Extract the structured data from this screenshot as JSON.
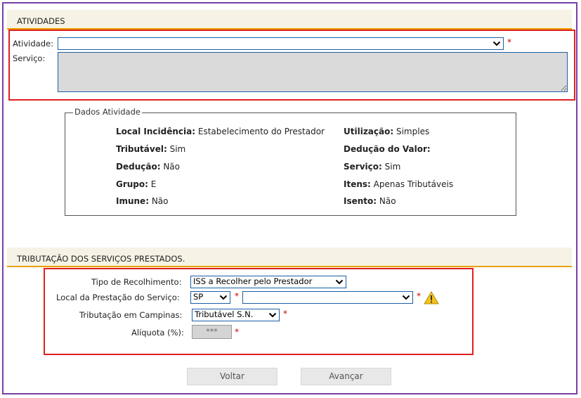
{
  "atividades": {
    "header": "ATIVIDADES",
    "atividade_label": "Atividade:",
    "atividade_value": "",
    "servico_label": "Serviço:",
    "servico_value": "",
    "required_mark": "*"
  },
  "dados_atividade": {
    "legend": "Dados Atividade",
    "rows": [
      {
        "k1": "Local Incidência:",
        "v1": "Estabelecimento do Prestador",
        "k2": "Utilização:",
        "v2": "Simples"
      },
      {
        "k1": "Tributável:",
        "v1": "Sim",
        "k2": "Dedução do Valor:",
        "v2": ""
      },
      {
        "k1": "Dedução:",
        "v1": "Não",
        "k2": "Serviço:",
        "v2": "Sim"
      },
      {
        "k1": "Grupo:",
        "v1": "E",
        "k2": "Itens:",
        "v2": "Apenas Tributáveis"
      },
      {
        "k1": "Imune:",
        "v1": "Não",
        "k2": "Isento:",
        "v2": "Não"
      }
    ]
  },
  "tributacao": {
    "header": "TRIBUTAÇÃO DOS SERVIÇOS PRESTADOS.",
    "tipo_label": "Tipo de Recolhimento:",
    "tipo_value": "ISS a Recolher pelo Prestador",
    "local_label": "Local da Prestação do Serviço:",
    "local_uf": "SP",
    "local_cidade": "",
    "trib_label": "Tributação em Campinas:",
    "trib_value": "Tributável S.N.",
    "aliquota_label": "Alíquota (%):",
    "aliquota_value": "***",
    "required_mark": "*"
  },
  "buttons": {
    "voltar": "Voltar",
    "avancar": "Avançar"
  },
  "colors": {
    "frame": "#7a3fa6",
    "highlight": "#e02020",
    "header_bg": "#f6f3e6",
    "header_border": "#e8a200",
    "select_border": "#1a5fa8"
  }
}
